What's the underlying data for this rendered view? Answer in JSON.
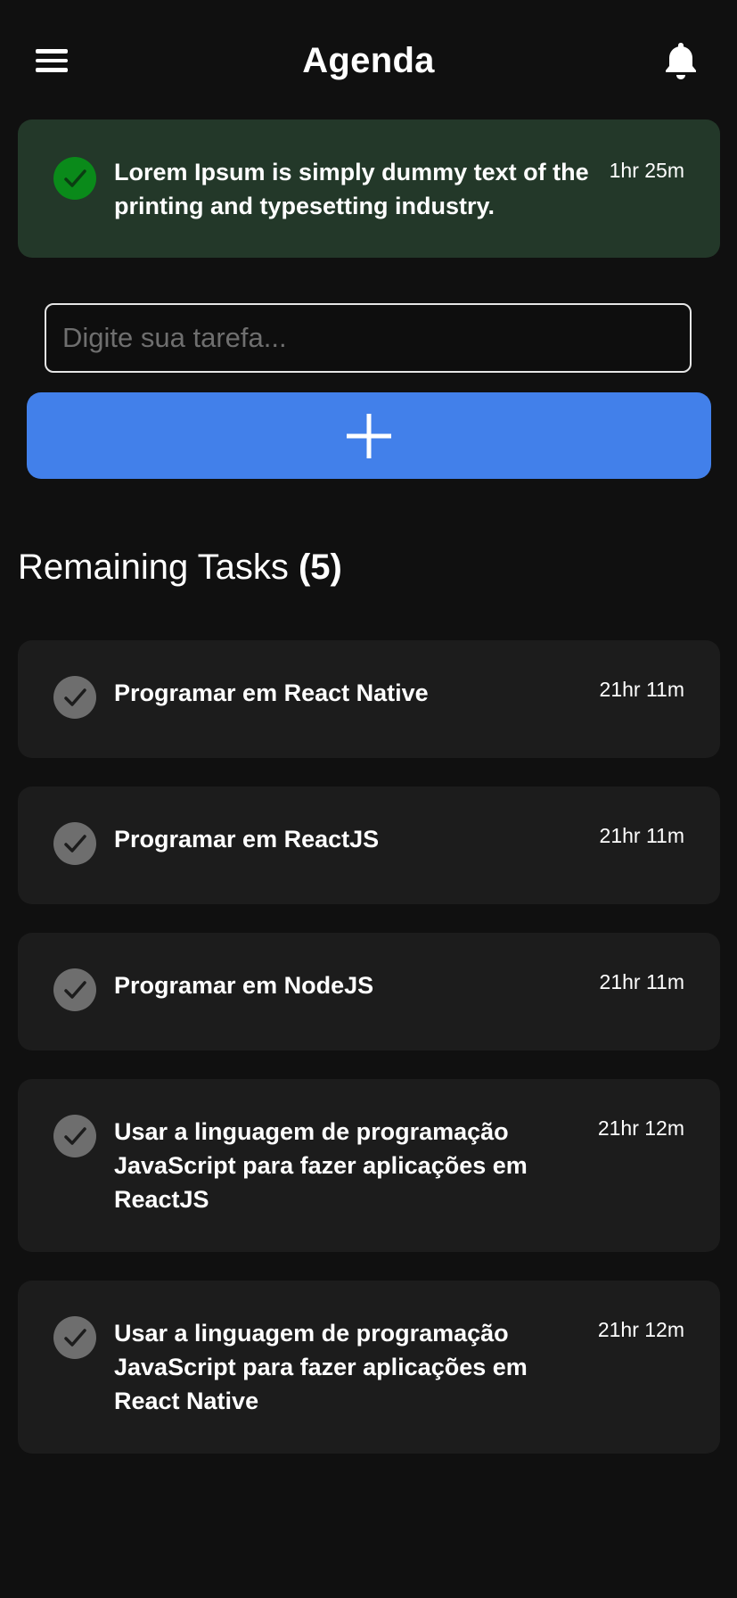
{
  "header": {
    "title": "Agenda",
    "menu_icon": "hamburger-menu-icon",
    "notification_icon": "bell-icon"
  },
  "banner": {
    "text": "Lorem Ipsum is simply dummy text of the printing and typesetting industry.",
    "time": "1hr 25m",
    "status": "completed",
    "color": "#233829",
    "check_color": "#0a8a1a"
  },
  "new_task": {
    "value": "",
    "placeholder": "Digite sua tarefa...",
    "add_icon": "plus-icon",
    "button_color": "#4280ea"
  },
  "remaining": {
    "label": "Remaining Tasks",
    "count": "(5)"
  },
  "tasks": [
    {
      "text": "Programar em React Native",
      "time": "21hr 11m"
    },
    {
      "text": "Programar em ReactJS",
      "time": "21hr 11m"
    },
    {
      "text": "Programar em NodeJS",
      "time": "21hr 11m"
    },
    {
      "text": "Usar a linguagem de programação JavaScript para fazer aplicações em ReactJS",
      "time": "21hr 12m"
    },
    {
      "text": "Usar a linguagem de programação JavaScript para fazer aplicações em React Native",
      "time": "21hr 12m"
    }
  ],
  "colors": {
    "background": "#101010",
    "card": "#1c1c1c",
    "pending_check": "#6e6e6e"
  }
}
